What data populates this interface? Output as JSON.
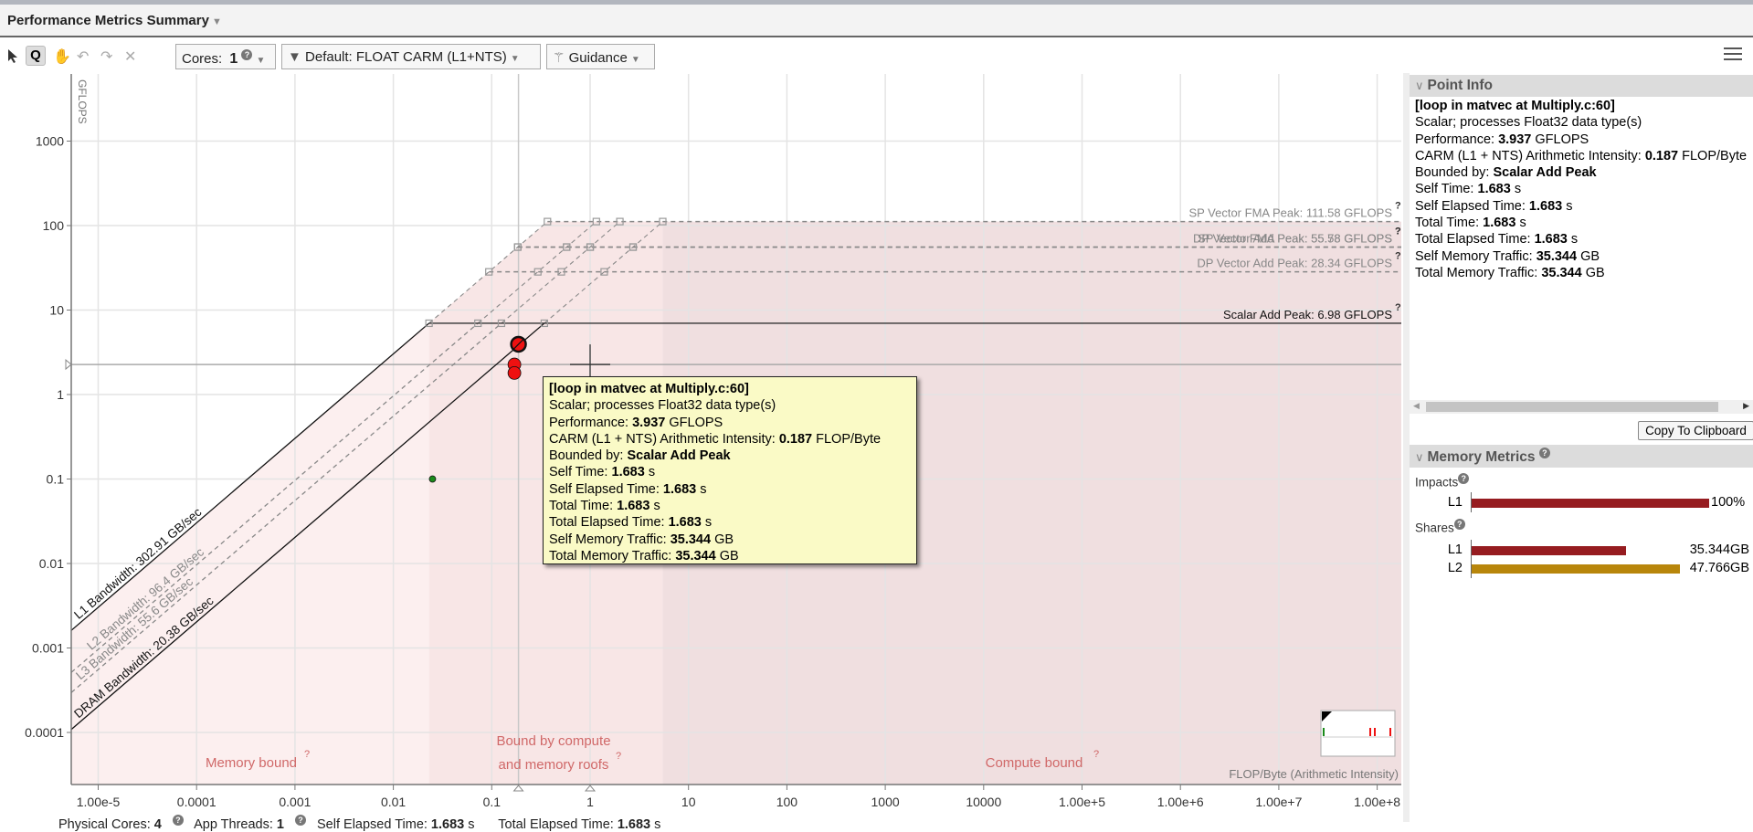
{
  "header": {
    "title": "Performance Metrics Summary"
  },
  "toolbar": {
    "cores_label": "Cores:",
    "cores_value": "1",
    "filter_label": "Default: FLOAT CARM (L1+NTS)",
    "guidance_label": "Guidance"
  },
  "chart_data": {
    "type": "scatter",
    "ylabel": "GFLOPS",
    "xlabel": "FLOP/Byte (Arithmetic Intensity)",
    "x_scale": "log",
    "y_scale": "log",
    "xlim": [
      5e-06,
      150000000
    ],
    "ylim": [
      3e-05,
      5000
    ],
    "x_ticks": [
      {
        "v": 1e-05,
        "label": "1.00e-5"
      },
      {
        "v": 0.0001,
        "label": "0.0001"
      },
      {
        "v": 0.001,
        "label": "0.001"
      },
      {
        "v": 0.01,
        "label": "0.01"
      },
      {
        "v": 0.1,
        "label": "0.1"
      },
      {
        "v": 1,
        "label": "1"
      },
      {
        "v": 10,
        "label": "10"
      },
      {
        "v": 100,
        "label": "100"
      },
      {
        "v": 1000,
        "label": "1000"
      },
      {
        "v": 10000,
        "label": "10000"
      },
      {
        "v": 100000,
        "label": "1.00e+5"
      },
      {
        "v": 1000000,
        "label": "1.00e+6"
      },
      {
        "v": 10000000,
        "label": "1.00e+7"
      },
      {
        "v": 100000000,
        "label": "1.00e+8"
      }
    ],
    "y_ticks": [
      {
        "v": 1000,
        "label": "1000"
      },
      {
        "v": 100,
        "label": "100"
      },
      {
        "v": 10,
        "label": "10"
      },
      {
        "v": 1,
        "label": "1"
      },
      {
        "v": 0.1,
        "label": "0.1"
      },
      {
        "v": 0.01,
        "label": "0.01"
      },
      {
        "v": 0.001,
        "label": "0.001"
      },
      {
        "v": 0.0001,
        "label": "0.0001"
      }
    ],
    "grid": true,
    "compute_roofs": [
      {
        "label": "SP Vector FMA Peak: 111.58 GFLOPS",
        "value": 111.58,
        "dashed": true
      },
      {
        "label": "DP Vector FMA Peak: 55.78 GFLOPS",
        "value": 55.78,
        "dashed": true
      },
      {
        "label": "SP Vector Add Peak: 55.58 GFLOPS",
        "value": 55.58,
        "dashed": true
      },
      {
        "label": "DP Vector Add Peak: 28.34 GFLOPS",
        "value": 28.34,
        "dashed": true
      },
      {
        "label": "Scalar Add Peak: 6.98 GFLOPS",
        "value": 6.98,
        "dashed": false
      }
    ],
    "memory_roofs": [
      {
        "label": "L1 Bandwidth: 302.91 GB/sec",
        "value": 302.91,
        "dashed": false
      },
      {
        "label": "L2 Bandwidth: 96.4 GB/sec",
        "value": 96.4,
        "dashed": true
      },
      {
        "label": "L3 Bandwidth: 55.6 GB/sec",
        "value": 55.6,
        "dashed": true
      },
      {
        "label": "DRAM Bandwidth: 20.38 GB/sec",
        "value": 20.38,
        "dashed": false
      }
    ],
    "points": [
      {
        "x": 0.187,
        "y": 3.937,
        "color": "#ee1111",
        "selected": true
      },
      {
        "x": 0.17,
        "y": 2.27,
        "color": "#ee1111"
      },
      {
        "x": 0.17,
        "y": 1.8,
        "color": "#ee1111"
      },
      {
        "x": 0.025,
        "y": 0.1,
        "color": "#1a8a1a"
      }
    ],
    "crosshair": {
      "x": 1,
      "y": 2.27
    },
    "selection_guides": {
      "x": 0.187,
      "y": 2.27
    },
    "regions": [
      {
        "label": "Memory bound",
        "color": "#fcefef"
      },
      {
        "label_line1": "Bound by compute",
        "label_line2": "and memory roofs",
        "color": "#f8e6e6"
      },
      {
        "label": "Compute bound",
        "color": "#f0dfe0"
      }
    ],
    "help_mark": "?"
  },
  "tooltip": {
    "title": "[loop in matvec at Multiply.c:60]",
    "lines": [
      {
        "k": "Scalar; processes Float32 data type(s)",
        "v": "",
        "u": ""
      },
      {
        "k": "Performance: ",
        "v": "3.937",
        "u": " GFLOPS"
      },
      {
        "k": "CARM (L1 + NTS) Arithmetic Intensity: ",
        "v": "0.187",
        "u": " FLOP/Byte"
      },
      {
        "k": "Bounded by: ",
        "v": "Scalar Add Peak",
        "u": ""
      },
      {
        "k": "Self Time: ",
        "v": "1.683",
        "u": " s"
      },
      {
        "k": "Self Elapsed Time: ",
        "v": "1.683",
        "u": " s"
      },
      {
        "k": "Total Time: ",
        "v": "1.683",
        "u": " s"
      },
      {
        "k": "Total Elapsed Time: ",
        "v": "1.683",
        "u": " s"
      },
      {
        "k": "Self Memory Traffic: ",
        "v": "35.344",
        "u": " GB"
      },
      {
        "k": "Total Memory Traffic: ",
        "v": "35.344",
        "u": " GB"
      }
    ]
  },
  "point_info": {
    "header": "Point Info",
    "copy_button": "Copy To Clipboard"
  },
  "memory_metrics": {
    "header": "Memory Metrics",
    "impacts_label": "Impacts",
    "shares_label": "Shares",
    "impacts": [
      {
        "level": "L1",
        "percent": 100,
        "label": "100%",
        "color": "#961c20"
      }
    ],
    "shares": [
      {
        "level": "L1",
        "gb": 35.344,
        "label": "35.344GB",
        "color": "#961c20"
      },
      {
        "level": "L2",
        "gb": 47.766,
        "label": "47.766GB",
        "color": "#b8860b"
      }
    ]
  },
  "status": {
    "physical_cores_label": "Physical Cores:",
    "physical_cores": "4",
    "app_threads_label": "App Threads:",
    "app_threads": "1",
    "self_elapsed_label": "Self Elapsed Time:",
    "self_elapsed": "1.683",
    "self_elapsed_unit": "s",
    "total_elapsed_label": "Total Elapsed Time:",
    "total_elapsed": "1.683",
    "total_elapsed_unit": "s"
  }
}
